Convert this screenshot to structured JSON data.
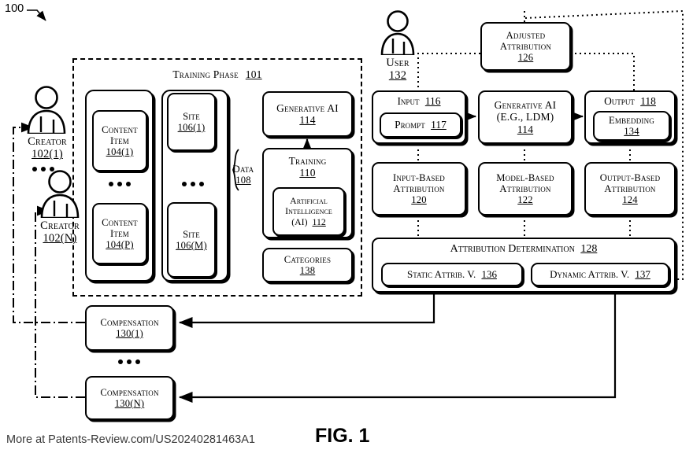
{
  "figure": {
    "number_tag": "100",
    "caption": "FIG. 1",
    "credit": "More at Patents-Review.com/US20240281463A1"
  },
  "training_phase": {
    "title": "Training Phase",
    "ref": "101",
    "data_label": "Data",
    "data_ref": "108",
    "content_items": [
      {
        "line1": "Content",
        "line2": "Item",
        "ref": "104(1)"
      },
      {
        "line1": "Content",
        "line2": "Item",
        "ref": "104(P)"
      }
    ],
    "sites": [
      {
        "line1": "Site",
        "ref": "106(1)"
      },
      {
        "line1": "Site",
        "ref": "106(M)"
      }
    ],
    "generative_ai": {
      "line1": "Generative AI",
      "ref": "114"
    },
    "training": {
      "line1": "Training",
      "ref": "110"
    },
    "artificial_intelligence": {
      "line1": "Artificial",
      "line2": "Intelligence",
      "line3": "(AI)",
      "ref": "112"
    },
    "categories": {
      "line1": "Categories",
      "ref": "138"
    },
    "ellipsis": "•••"
  },
  "creators": [
    {
      "label": "Creator",
      "ref": "102(1)"
    },
    {
      "label": "Creator",
      "ref": "102(N)"
    }
  ],
  "user": {
    "label": "User",
    "ref": "132"
  },
  "inference": {
    "adjusted_attribution": {
      "line1": "Adjusted",
      "line2": "Attribution",
      "ref": "126"
    },
    "input": {
      "label": "Input",
      "ref": "116"
    },
    "prompt": {
      "label": "Prompt",
      "ref": "117"
    },
    "generative_ai": {
      "line1": "Generative AI",
      "line2": "(E.G., LDM)",
      "ref": "114"
    },
    "output": {
      "label": "Output",
      "ref": "118"
    },
    "embedding": {
      "label": "Embedding",
      "ref": "134"
    },
    "input_based_attribution": {
      "line1": "Input-Based",
      "line2": "Attribution",
      "ref": "120"
    },
    "model_based_attribution": {
      "line1": "Model-Based",
      "line2": "Attribution",
      "ref": "122"
    },
    "output_based_attribution": {
      "line1": "Output-Based",
      "line2": "Attribution",
      "ref": "124"
    },
    "attribution_determination": {
      "label": "Attribution Determination",
      "ref": "128"
    },
    "static_attrib": {
      "label": "Static Attrib. V.",
      "ref": "136"
    },
    "dynamic_attrib": {
      "label": "Dynamic Attrib. V.",
      "ref": "137"
    }
  },
  "compensation": [
    {
      "label": "Compensation",
      "ref": "130(1)"
    },
    {
      "label": "Compensation",
      "ref": "130(N)"
    }
  ],
  "colors": {
    "stroke": "#000000",
    "fill": "#ffffff",
    "credit": "#3a3a3a"
  }
}
